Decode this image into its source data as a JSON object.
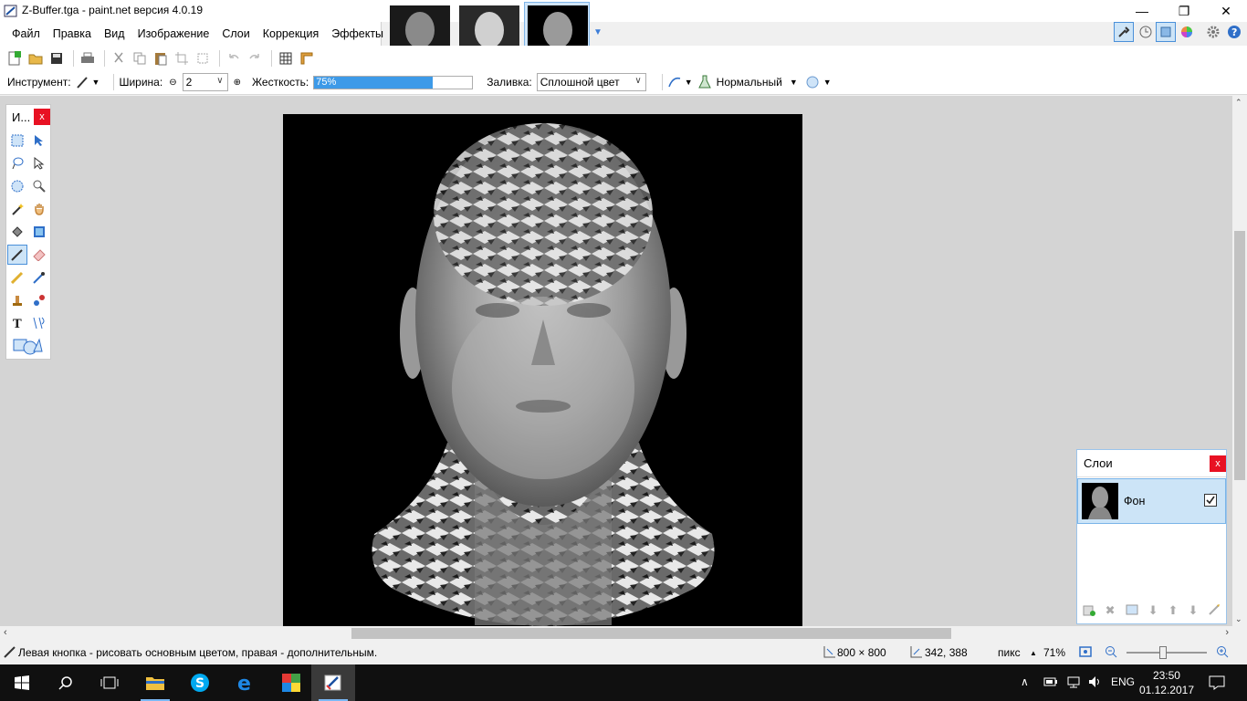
{
  "window": {
    "title": "Z-Buffer.tga - paint.net версия 4.0.19",
    "minimize_glyph": "—",
    "maximize_glyph": "❐",
    "close_glyph": "✕"
  },
  "menu": [
    "Файл",
    "Правка",
    "Вид",
    "Изображение",
    "Слои",
    "Коррекция",
    "Эффекты"
  ],
  "thumbnails": [
    {
      "name": "thumb-1",
      "active": false
    },
    {
      "name": "thumb-2",
      "active": false
    },
    {
      "name": "thumb-3",
      "active": true
    }
  ],
  "options": {
    "tool_label": "Инструмент:",
    "width_label": "Ширина:",
    "width_value": "2",
    "hardness_label": "Жесткость:",
    "hardness_value": "75%",
    "hardness_fraction": 0.75,
    "fill_label": "Заливка:",
    "fill_value": "Сплошной цвет",
    "blend_value": "Нормальный"
  },
  "tools_window": {
    "title": "И...",
    "close": "x"
  },
  "layers_window": {
    "title": "Слои",
    "close": "x",
    "layers": [
      {
        "name": "Фон",
        "visible": true
      }
    ]
  },
  "status": {
    "hint": "Левая кнопка - рисовать основным цветом, правая - дополнительным.",
    "image_size": "800 × 800",
    "cursor_pos": "342, 388",
    "units": "пикс",
    "zoom": "71%"
  },
  "taskbar": {
    "lang": "ENG",
    "time": "23:50",
    "date": "01.12.2017"
  }
}
